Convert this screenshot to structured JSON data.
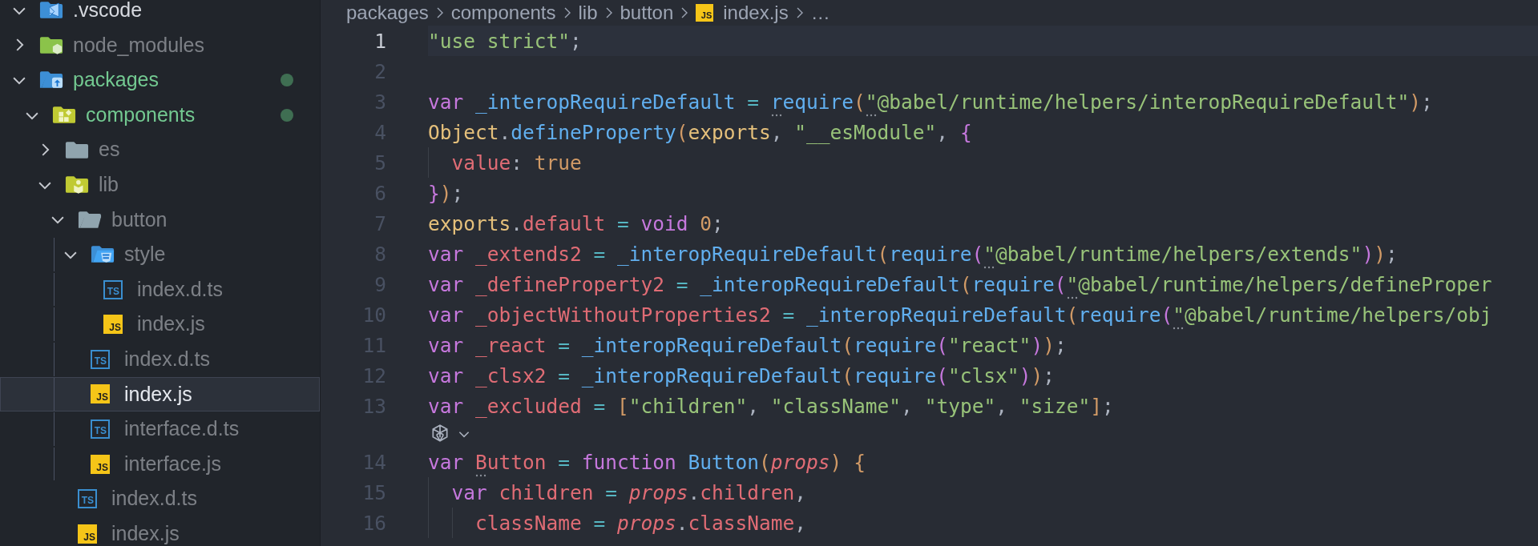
{
  "tree": [
    {
      "label": ".vscode",
      "kind": "vscode-folder",
      "expanded": true,
      "ignored": false,
      "modified": false,
      "selected": false
    },
    {
      "label": "node_modules",
      "kind": "node-folder",
      "expanded": false,
      "ignored": true,
      "modified": false,
      "selected": false
    },
    {
      "label": "packages",
      "kind": "package-folder",
      "expanded": true,
      "ignored": false,
      "modified": true,
      "selected": false,
      "children": [
        {
          "label": "components",
          "kind": "component-folder",
          "expanded": true,
          "ignored": false,
          "modified": true,
          "selected": false,
          "children": [
            {
              "label": "es",
              "kind": "folder",
              "expanded": false,
              "ignored": true,
              "modified": false,
              "selected": false
            },
            {
              "label": "lib",
              "kind": "lib-folder",
              "expanded": true,
              "ignored": true,
              "modified": false,
              "selected": false,
              "children": [
                {
                  "label": "button",
                  "kind": "folder",
                  "expanded": true,
                  "ignored": true,
                  "modified": false,
                  "selected": false,
                  "children": [
                    {
                      "label": "style",
                      "kind": "style-folder",
                      "expanded": true,
                      "ignored": true,
                      "modified": false,
                      "selected": false,
                      "children": [
                        {
                          "label": "index.d.ts",
                          "kind": "ts-file",
                          "icon_text": "TS",
                          "ignored": true,
                          "modified": false,
                          "selected": false
                        },
                        {
                          "label": "index.js",
                          "kind": "js-file",
                          "icon_text": "JS",
                          "ignored": true,
                          "modified": false,
                          "selected": false
                        }
                      ]
                    },
                    {
                      "label": "index.d.ts",
                      "kind": "ts-file",
                      "icon_text": "TS",
                      "ignored": true,
                      "modified": false,
                      "selected": false
                    },
                    {
                      "label": "index.js",
                      "kind": "js-file",
                      "icon_text": "JS",
                      "ignored": true,
                      "modified": false,
                      "selected": true
                    },
                    {
                      "label": "interface.d.ts",
                      "kind": "ts-file",
                      "icon_text": "TS",
                      "ignored": true,
                      "modified": false,
                      "selected": false
                    },
                    {
                      "label": "interface.js",
                      "kind": "js-file",
                      "icon_text": "JS",
                      "ignored": true,
                      "modified": false,
                      "selected": false
                    }
                  ]
                },
                {
                  "label": "index.d.ts",
                  "kind": "ts-file",
                  "icon_text": "TS",
                  "ignored": true,
                  "modified": false,
                  "selected": false
                },
                {
                  "label": "index.js",
                  "kind": "js-file",
                  "icon_text": "JS",
                  "ignored": true,
                  "modified": false,
                  "selected": false
                }
              ]
            }
          ]
        }
      ]
    }
  ],
  "breadcrumb": [
    {
      "label": "packages"
    },
    {
      "label": "components"
    },
    {
      "label": "lib"
    },
    {
      "label": "button"
    },
    {
      "label": "index.js",
      "icon_text": "JS"
    },
    {
      "label": "…"
    }
  ],
  "lines": [
    {
      "kind": "code",
      "number": "1",
      "current": true,
      "tokens": [
        {
          "t": "\"use strict\"",
          "kind": "str"
        },
        {
          "t": ";",
          "kind": "p"
        }
      ]
    },
    {
      "kind": "code",
      "number": "2",
      "current": false
    },
    {
      "kind": "code",
      "number": "3",
      "current": false,
      "tokens": [
        {
          "t": "var ",
          "kind": "kw"
        },
        {
          "t": "_interopRequireDefault",
          "kind": "fn"
        },
        {
          "t": " = ",
          "kind": "op"
        },
        {
          "t": "require",
          "kind": "fn",
          "hint": true
        },
        {
          "t": "(",
          "kind": "b1"
        },
        {
          "t": "\"@babel/runtime/helpers/interopRequireDefault\"",
          "kind": "str",
          "hint": true
        },
        {
          "t": ")",
          "kind": "b1"
        },
        {
          "t": ";",
          "kind": "p"
        }
      ]
    },
    {
      "kind": "code",
      "number": "4",
      "current": false,
      "tokens": [
        {
          "t": "Object",
          "kind": "obj"
        },
        {
          "t": ".",
          "kind": "p"
        },
        {
          "t": "defineProperty",
          "kind": "fn"
        },
        {
          "t": "(",
          "kind": "b1"
        },
        {
          "t": "exports",
          "kind": "obj"
        },
        {
          "t": ", ",
          "kind": "p"
        },
        {
          "t": "\"__esModule\"",
          "kind": "str"
        },
        {
          "t": ", ",
          "kind": "p"
        },
        {
          "t": "{",
          "kind": "b2"
        }
      ]
    },
    {
      "kind": "code",
      "number": "5",
      "current": false,
      "tokens": [
        {
          "t": "  value",
          "kind": "prop"
        },
        {
          "t": ": ",
          "kind": "p"
        },
        {
          "t": "true",
          "kind": "num"
        }
      ]
    },
    {
      "kind": "code",
      "number": "6",
      "current": false,
      "tokens": [
        {
          "t": "}",
          "kind": "b2"
        },
        {
          "t": ")",
          "kind": "b1"
        },
        {
          "t": ";",
          "kind": "p"
        }
      ]
    },
    {
      "kind": "code",
      "number": "7",
      "current": false,
      "tokens": [
        {
          "t": "exports",
          "kind": "obj"
        },
        {
          "t": ".",
          "kind": "p"
        },
        {
          "t": "default",
          "kind": "prop"
        },
        {
          "t": " = ",
          "kind": "op"
        },
        {
          "t": "void ",
          "kind": "kw"
        },
        {
          "t": "0",
          "kind": "num"
        },
        {
          "t": ";",
          "kind": "p"
        }
      ]
    },
    {
      "kind": "code",
      "number": "8",
      "current": false,
      "tokens": [
        {
          "t": "var ",
          "kind": "kw"
        },
        {
          "t": "_extends2",
          "kind": "var"
        },
        {
          "t": " = ",
          "kind": "op"
        },
        {
          "t": "_interopRequireDefault",
          "kind": "fn"
        },
        {
          "t": "(",
          "kind": "b1"
        },
        {
          "t": "require",
          "kind": "fn"
        },
        {
          "t": "(",
          "kind": "b2"
        },
        {
          "t": "\"@babel/runtime/helpers/extends\"",
          "kind": "str",
          "hint": true
        },
        {
          "t": ")",
          "kind": "b2"
        },
        {
          "t": ")",
          "kind": "b1"
        },
        {
          "t": ";",
          "kind": "p"
        }
      ]
    },
    {
      "kind": "code",
      "number": "9",
      "current": false,
      "tokens": [
        {
          "t": "var ",
          "kind": "kw"
        },
        {
          "t": "_defineProperty2",
          "kind": "var"
        },
        {
          "t": " = ",
          "kind": "op"
        },
        {
          "t": "_interopRequireDefault",
          "kind": "fn"
        },
        {
          "t": "(",
          "kind": "b1"
        },
        {
          "t": "require",
          "kind": "fn"
        },
        {
          "t": "(",
          "kind": "b2"
        },
        {
          "t": "\"@babel/runtime/helpers/defineProper",
          "kind": "str",
          "hint": true
        }
      ]
    },
    {
      "kind": "code",
      "number": "10",
      "current": false,
      "tokens": [
        {
          "t": "var ",
          "kind": "kw"
        },
        {
          "t": "_objectWithoutProperties2",
          "kind": "var"
        },
        {
          "t": " = ",
          "kind": "op"
        },
        {
          "t": "_interopRequireDefault",
          "kind": "fn"
        },
        {
          "t": "(",
          "kind": "b1"
        },
        {
          "t": "require",
          "kind": "fn"
        },
        {
          "t": "(",
          "kind": "b2"
        },
        {
          "t": "\"@babel/runtime/helpers/obj",
          "kind": "str",
          "hint": true
        }
      ]
    },
    {
      "kind": "code",
      "number": "11",
      "current": false,
      "tokens": [
        {
          "t": "var ",
          "kind": "kw"
        },
        {
          "t": "_react",
          "kind": "var"
        },
        {
          "t": " = ",
          "kind": "op"
        },
        {
          "t": "_interopRequireDefault",
          "kind": "fn"
        },
        {
          "t": "(",
          "kind": "b1"
        },
        {
          "t": "require",
          "kind": "fn"
        },
        {
          "t": "(",
          "kind": "b2"
        },
        {
          "t": "\"react\"",
          "kind": "str"
        },
        {
          "t": ")",
          "kind": "b2"
        },
        {
          "t": ")",
          "kind": "b1"
        },
        {
          "t": ";",
          "kind": "p"
        }
      ]
    },
    {
      "kind": "code",
      "number": "12",
      "current": false,
      "tokens": [
        {
          "t": "var ",
          "kind": "kw"
        },
        {
          "t": "_clsx2",
          "kind": "var"
        },
        {
          "t": " = ",
          "kind": "op"
        },
        {
          "t": "_interopRequireDefault",
          "kind": "fn"
        },
        {
          "t": "(",
          "kind": "b1"
        },
        {
          "t": "require",
          "kind": "fn"
        },
        {
          "t": "(",
          "kind": "b2"
        },
        {
          "t": "\"clsx\"",
          "kind": "str"
        },
        {
          "t": ")",
          "kind": "b2"
        },
        {
          "t": ")",
          "kind": "b1"
        },
        {
          "t": ";",
          "kind": "p"
        }
      ]
    },
    {
      "kind": "code",
      "number": "13",
      "current": false,
      "tokens": [
        {
          "t": "var ",
          "kind": "kw"
        },
        {
          "t": "_excluded",
          "kind": "var"
        },
        {
          "t": " = ",
          "kind": "op"
        },
        {
          "t": "[",
          "kind": "b1"
        },
        {
          "t": "\"children\"",
          "kind": "str"
        },
        {
          "t": ", ",
          "kind": "p"
        },
        {
          "t": "\"className\"",
          "kind": "str"
        },
        {
          "t": ", ",
          "kind": "p"
        },
        {
          "t": "\"type\"",
          "kind": "str"
        },
        {
          "t": ", ",
          "kind": "p"
        },
        {
          "t": "\"size\"",
          "kind": "str"
        },
        {
          "t": "]",
          "kind": "b1"
        },
        {
          "t": ";",
          "kind": "p"
        }
      ]
    },
    {
      "kind": "codelens"
    },
    {
      "kind": "code",
      "number": "14",
      "current": false,
      "tokens": [
        {
          "t": "var ",
          "kind": "kw"
        },
        {
          "t": "Button",
          "kind": "var",
          "hint": true
        },
        {
          "t": " = ",
          "kind": "op"
        },
        {
          "t": "function ",
          "kind": "kw"
        },
        {
          "t": "Button",
          "kind": "fn"
        },
        {
          "t": "(",
          "kind": "b1"
        },
        {
          "t": "props",
          "kind": "param"
        },
        {
          "t": ") ",
          "kind": "b1"
        },
        {
          "t": "{",
          "kind": "b1"
        }
      ]
    },
    {
      "kind": "code",
      "number": "15",
      "current": false,
      "tokens": [
        {
          "t": "  var ",
          "kind": "kw"
        },
        {
          "t": "children",
          "kind": "var"
        },
        {
          "t": " = ",
          "kind": "op"
        },
        {
          "t": "props",
          "kind": "param"
        },
        {
          "t": ".",
          "kind": "p"
        },
        {
          "t": "children",
          "kind": "prop"
        },
        {
          "t": ",",
          "kind": "p"
        }
      ]
    },
    {
      "kind": "code",
      "number": "16",
      "current": false,
      "tokens": [
        {
          "t": "    className",
          "kind": "var"
        },
        {
          "t": " = ",
          "kind": "op"
        },
        {
          "t": "props",
          "kind": "param"
        },
        {
          "t": ".",
          "kind": "p"
        },
        {
          "t": "className",
          "kind": "prop"
        },
        {
          "t": ",",
          "kind": "p"
        }
      ]
    }
  ]
}
